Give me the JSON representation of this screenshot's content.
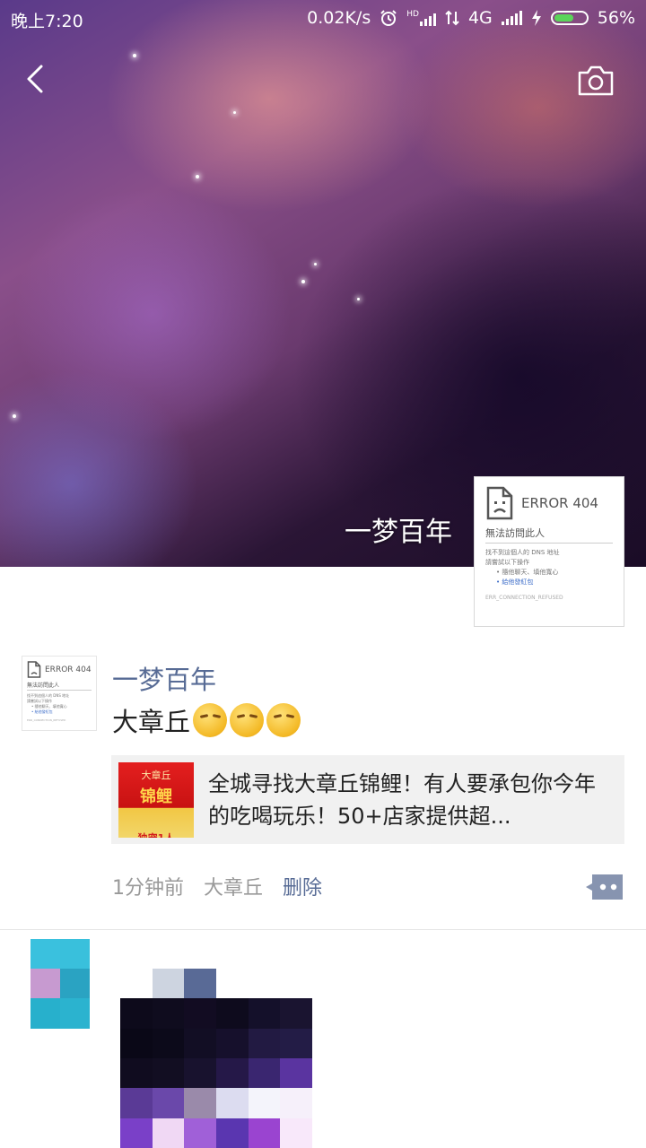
{
  "status_bar": {
    "time": "晚上7:20",
    "speed": "0.02K/s",
    "hd_label": "HD",
    "network": "4G",
    "battery": "56%"
  },
  "cover": {
    "name": "一梦百年"
  },
  "avatar_error": {
    "code": "ERROR 404",
    "title": "無法訪問此人",
    "line1": "找不到這個人的 DNS 地址",
    "line2": "請嘗試以下操作",
    "bullet1": "隨他聊天、填他寬心",
    "bullet2": "給他發紅包",
    "footer": "ERR_CONNECTION_REFUSED"
  },
  "post": {
    "author": "一梦百年",
    "text": "大章丘",
    "share": {
      "thumb_top": "大章丘",
      "thumb_main": "锦鲤",
      "thumb_bottom": "独宠1人",
      "title": "全城寻找大章丘锦鲤！有人要承包你今年的吃喝玩乐！50+店家提供超..."
    },
    "time": "1分钟前",
    "location": "大章丘",
    "delete_label": "删除"
  },
  "icons": {
    "back": "back-arrow-icon",
    "camera": "camera-icon",
    "more": "more-comment-icon"
  },
  "colors": {
    "link": "#576b95",
    "card_bg": "#f1f1f1",
    "meta_gray": "#999999"
  }
}
